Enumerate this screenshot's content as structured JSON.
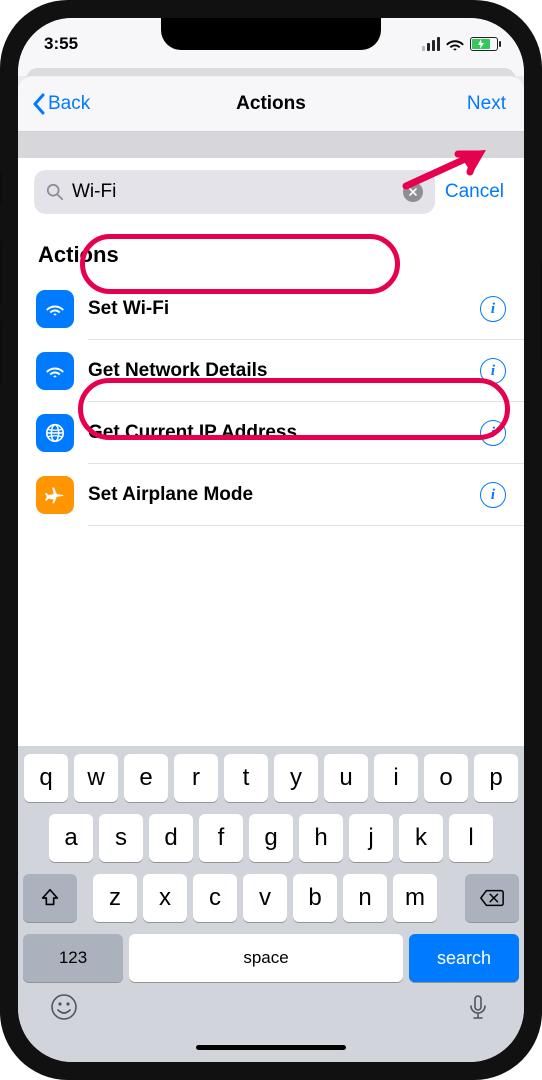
{
  "status": {
    "time": "3:55"
  },
  "nav": {
    "back": "Back",
    "title": "Actions",
    "next": "Next"
  },
  "search": {
    "value": "Wi-Fi",
    "cancel": "Cancel"
  },
  "section_title": "Actions",
  "actions": [
    {
      "label": "Set Wi-Fi",
      "icon": "wifi",
      "icon_bg": "#007aff"
    },
    {
      "label": "Get Network Details",
      "icon": "wifi",
      "icon_bg": "#007aff"
    },
    {
      "label": "Get Current IP Address",
      "icon": "globe",
      "icon_bg": "#007aff"
    },
    {
      "label": "Set Airplane Mode",
      "icon": "plane",
      "icon_bg": "#ff9500"
    }
  ],
  "keyboard": {
    "row1": [
      "q",
      "w",
      "e",
      "r",
      "t",
      "y",
      "u",
      "i",
      "o",
      "p"
    ],
    "row2": [
      "a",
      "s",
      "d",
      "f",
      "g",
      "h",
      "j",
      "k",
      "l"
    ],
    "row3": [
      "z",
      "x",
      "c",
      "v",
      "b",
      "n",
      "m"
    ],
    "numbers": "123",
    "space": "space",
    "search": "search"
  }
}
